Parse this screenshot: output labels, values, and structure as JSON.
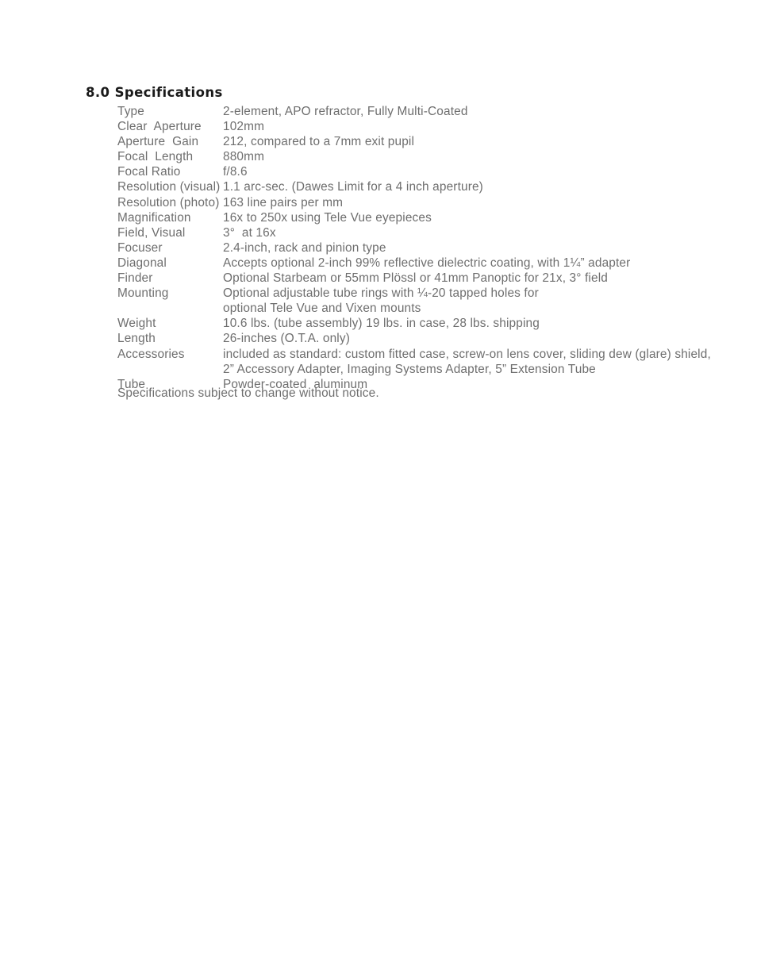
{
  "document": {
    "section_heading": "8.0 Specifications",
    "footnote": "Specifications subject to change without notice.",
    "text_color": "#6e6e6e",
    "heading_color": "#1a1a1a",
    "background_color": "#ffffff"
  },
  "specifications": [
    {
      "label": "Type",
      "value": "2-element, APO refractor, Fully Multi-Coated"
    },
    {
      "label": "Clear  Aperture",
      "value": "102mm"
    },
    {
      "label": "Aperture  Gain",
      "value": "212, compared to a 7mm exit pupil"
    },
    {
      "label": "Focal  Length",
      "value": "880mm"
    },
    {
      "label": "Focal Ratio",
      "value": "f/8.6"
    },
    {
      "label": "Resolution (visual)",
      "value": "1.1 arc-sec. (Dawes Limit for a 4 inch aperture)"
    },
    {
      "label": "Resolution (photo)",
      "value": "163 line pairs per mm"
    },
    {
      "label": "Magnification",
      "value": "16x to 250x using Tele Vue eyepieces"
    },
    {
      "label": "Field, Visual",
      "value": "3°  at 16x"
    },
    {
      "label": "Focuser",
      "value": "2.4-inch, rack and pinion type"
    },
    {
      "label": "Diagonal",
      "value": "Accepts optional 2-inch 99% reflective dielectric coating, with 1¼” adapter"
    },
    {
      "label": "Finder",
      "value": "Optional Starbeam or 55mm Plössl or 41mm Panoptic for 21x, 3° field"
    },
    {
      "label": "Mounting",
      "value": "Optional adjustable tube rings with ¼-20 tapped holes for"
    },
    {
      "label": "",
      "value": "optional Tele Vue and Vixen mounts",
      "continuation": true
    },
    {
      "label": "Weight",
      "value": "10.6 lbs. (tube assembly) 19 lbs. in case, 28 lbs. shipping"
    },
    {
      "label": "Length",
      "value": "26-inches (O.T.A. only)"
    },
    {
      "label": "Accessories",
      "value": "included as standard: custom fitted case, screw-on lens cover, sliding dew (glare) shield,"
    },
    {
      "label": "",
      "value": "2” Accessory Adapter, Imaging Systems Adapter, 5” Extension Tube",
      "continuation": true
    },
    {
      "label": "Tube",
      "value": "Powder-coated  aluminum"
    }
  ]
}
